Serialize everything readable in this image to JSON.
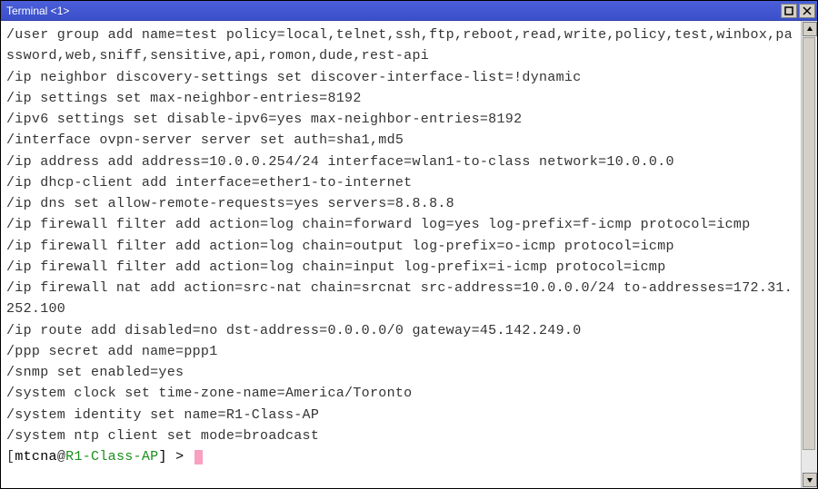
{
  "window": {
    "title": "Terminal <1>"
  },
  "terminal": {
    "lines": [
      "/user group add name=test policy=local,telnet,ssh,ftp,reboot,read,write,policy,test,winbox,password,web,sniff,sensitive,api,romon,dude,rest-api",
      "/ip neighbor discovery-settings set discover-interface-list=!dynamic",
      "/ip settings set max-neighbor-entries=8192",
      "/ipv6 settings set disable-ipv6=yes max-neighbor-entries=8192",
      "/interface ovpn-server server set auth=sha1,md5",
      "/ip address add address=10.0.0.254/24 interface=wlan1-to-class network=10.0.0.0",
      "/ip dhcp-client add interface=ether1-to-internet",
      "/ip dns set allow-remote-requests=yes servers=8.8.8.8",
      "/ip firewall filter add action=log chain=forward log=yes log-prefix=f-icmp protocol=icmp",
      "/ip firewall filter add action=log chain=output log-prefix=o-icmp protocol=icmp",
      "/ip firewall filter add action=log chain=input log-prefix=i-icmp protocol=icmp",
      "/ip firewall nat add action=src-nat chain=srcnat src-address=10.0.0.0/24 to-addresses=172.31.252.100",
      "/ip route add disabled=no dst-address=0.0.0.0/0 gateway=45.142.249.0",
      "/ppp secret add name=ppp1",
      "/snmp set enabled=yes",
      "/system clock set time-zone-name=America/Toronto",
      "/system identity set name=R1-Class-AP",
      "/system ntp client set mode=broadcast"
    ],
    "prompt": {
      "user": "mtcna",
      "at": "@",
      "host": "R1-Class-AP",
      "suffix": "] > "
    }
  }
}
